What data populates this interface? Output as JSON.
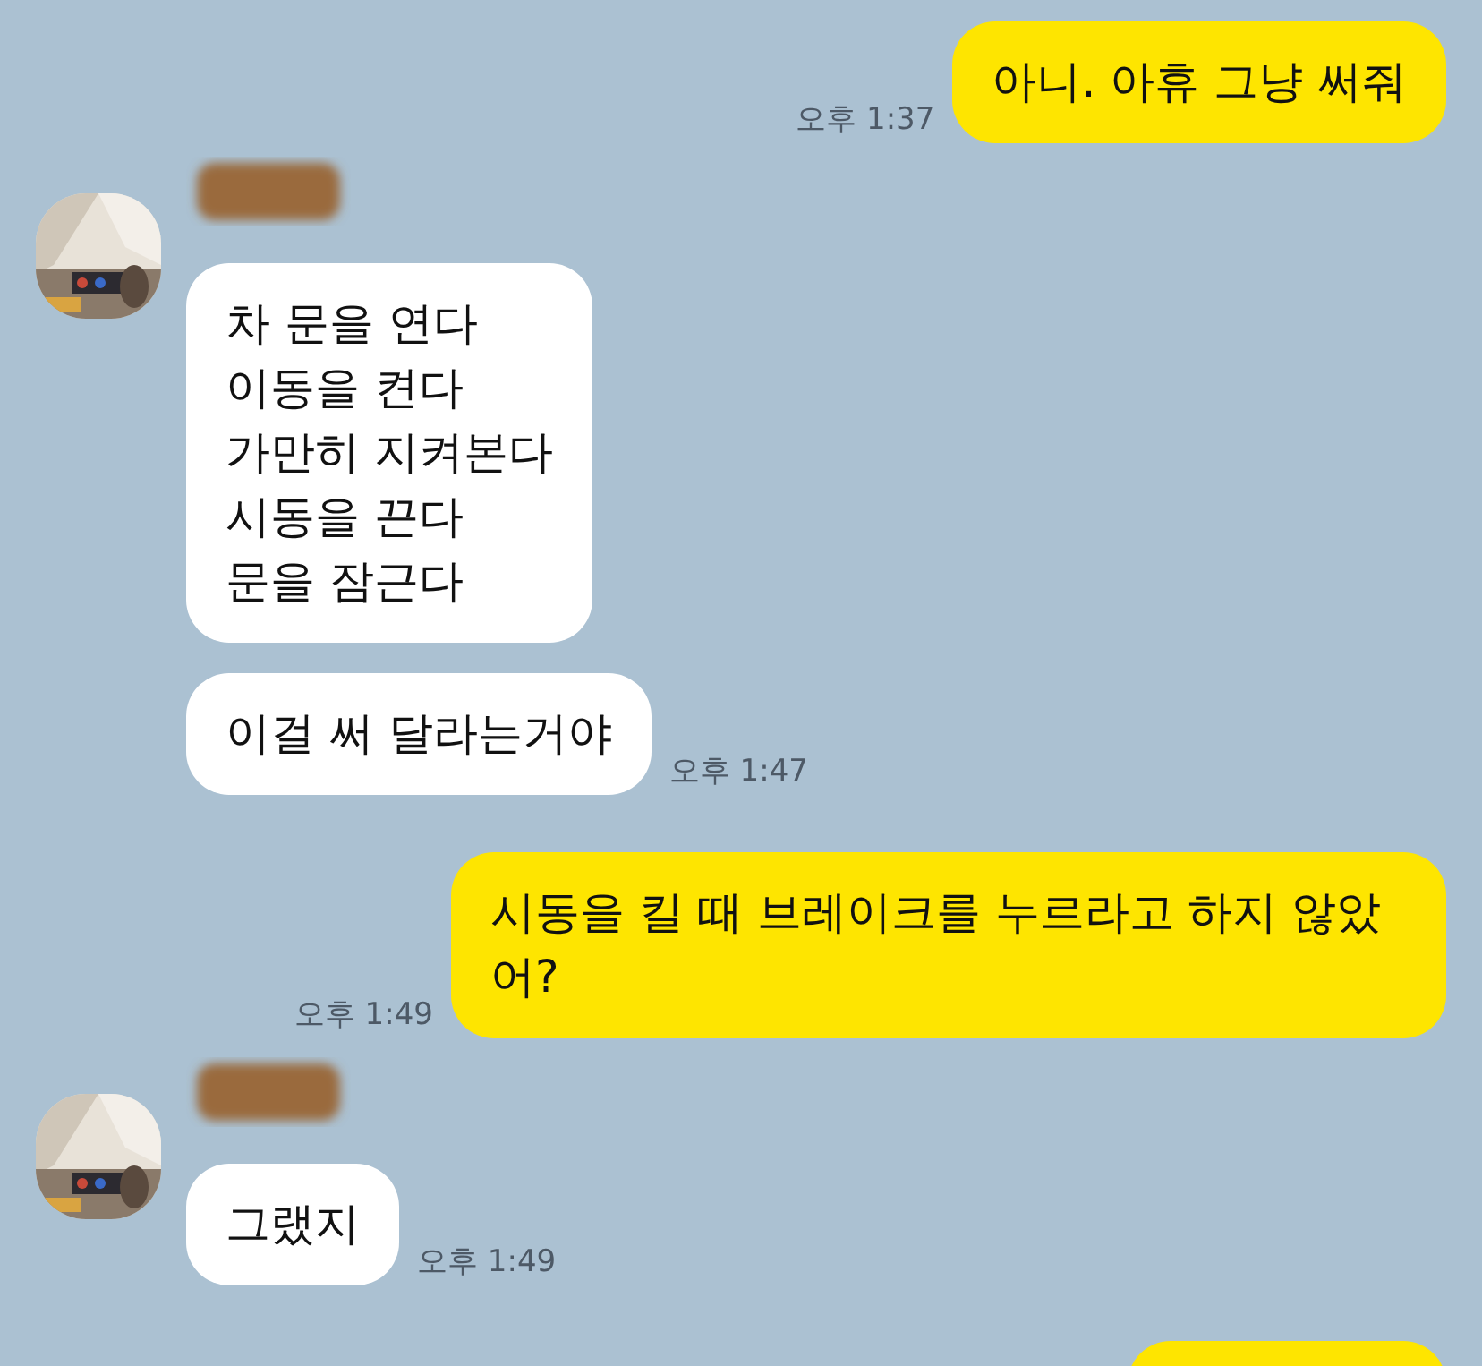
{
  "messages": [
    {
      "kind": "mine",
      "text": "아니. 아휴 그냥 써줘",
      "time": "오후 1:37"
    },
    {
      "kind": "theirs",
      "bubbles": [
        {
          "text": "차 문을 연다\n이동을 켠다\n가만히 지켜본다\n시동을 끈다\n문을 잠근다"
        },
        {
          "text": "이걸 써 달라는거야",
          "time": "오후 1:47"
        }
      ]
    },
    {
      "kind": "mine",
      "text": "시동을 킬 때 브레이크를 누르라고 하지 않았어?",
      "time": "오후 1:49"
    },
    {
      "kind": "theirs",
      "bubbles": [
        {
          "text": "그랬지",
          "time": "오후 1:49"
        }
      ]
    },
    {
      "kind": "mine",
      "cut_off": true
    }
  ]
}
